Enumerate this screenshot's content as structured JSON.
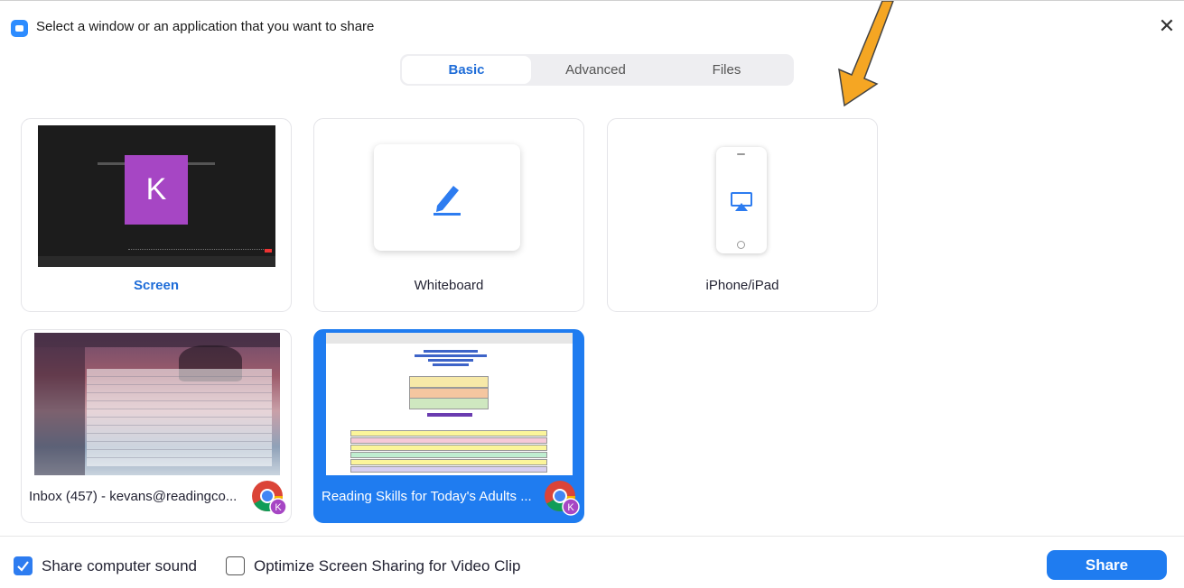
{
  "window": {
    "title": "Select a window or an application that you want to share",
    "close_glyph": "✕"
  },
  "tabs": [
    {
      "label": "Basic",
      "active": true
    },
    {
      "label": "Advanced",
      "active": false
    },
    {
      "label": "Files",
      "active": false
    }
  ],
  "share_options": [
    {
      "label": "Screen",
      "selected": false
    },
    {
      "label": "Whiteboard",
      "selected": false
    },
    {
      "label": "iPhone/iPad",
      "selected": false
    }
  ],
  "screen_thumb": {
    "avatar_letter": "K",
    "avatar_color": "#a646c4"
  },
  "windows": [
    {
      "caption": "Inbox (457) - kevans@readingco...",
      "app_icon": "chrome-icon",
      "selected": false
    },
    {
      "caption": "Reading Skills for Today's Adults ...",
      "app_icon": "chrome-icon",
      "selected": true
    }
  ],
  "badge_letter": "K",
  "footer": {
    "share_sound_label": "Share computer sound",
    "share_sound_checked": true,
    "optimize_label": "Optimize Screen Sharing for Video Clip",
    "optimize_checked": false,
    "share_button": "Share"
  },
  "colors": {
    "accent": "#1f7cf0",
    "annotation_arrow": "#f5a623"
  }
}
